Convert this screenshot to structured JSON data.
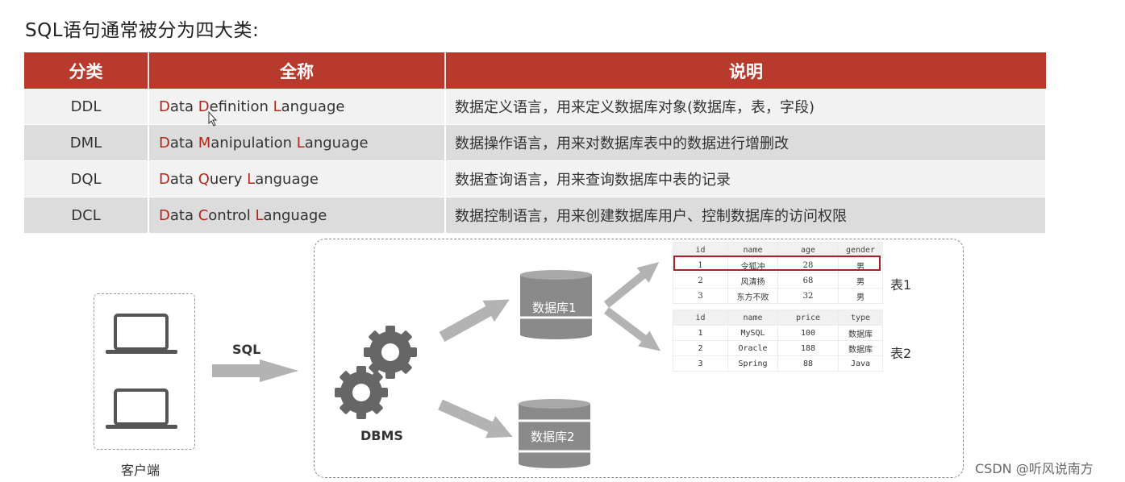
{
  "heading": "SQL语句通常被分为四大类:",
  "table": {
    "headers": [
      "分类",
      "全称",
      "说明"
    ],
    "rows": [
      {
        "abbr": "DDL",
        "full": [
          [
            "D",
            "ata "
          ],
          [
            "D",
            "efinition "
          ],
          [
            "L",
            "anguage"
          ]
        ],
        "desc": "数据定义语言，用来定义数据库对象(数据库，表，字段)"
      },
      {
        "abbr": "DML",
        "full": [
          [
            "D",
            "ata "
          ],
          [
            "M",
            "anipulation "
          ],
          [
            "L",
            "anguage"
          ]
        ],
        "desc": "数据操作语言，用来对数据库表中的数据进行增删改"
      },
      {
        "abbr": "DQL",
        "full": [
          [
            "D",
            "ata "
          ],
          [
            "Q",
            "uery "
          ],
          [
            "L",
            "anguage"
          ]
        ],
        "desc": "数据查询语言，用来查询数据库中表的记录"
      },
      {
        "abbr": "DCL",
        "full": [
          [
            "D",
            "ata "
          ],
          [
            "C",
            "ontrol "
          ],
          [
            "L",
            "anguage"
          ]
        ],
        "desc": "数据控制语言，用来创建数据库用户、控制数据库的访问权限"
      }
    ]
  },
  "diagram": {
    "client_label": "客户端",
    "sql_label": "SQL",
    "dbms_label": "DBMS",
    "db1_label": "数据库1",
    "db2_label": "数据库2",
    "table1_label": "表1",
    "table2_label": "表2",
    "table1": {
      "headers": [
        "id",
        "name",
        "age",
        "gender"
      ],
      "rows": [
        [
          "1",
          "令狐冲",
          "28",
          "男"
        ],
        [
          "2",
          "风清扬",
          "68",
          "男"
        ],
        [
          "3",
          "东方不败",
          "32",
          "男"
        ]
      ]
    },
    "table2": {
      "headers": [
        "id",
        "name",
        "price",
        "type"
      ],
      "rows": [
        [
          "1",
          "MySQL",
          "100",
          "数据库"
        ],
        [
          "2",
          "Oracle",
          "188",
          "数据库"
        ],
        [
          "3",
          "Spring",
          "88",
          "Java"
        ]
      ]
    }
  },
  "watermark": "CSDN @听风说南方",
  "colors": {
    "header_red": "#b83a2d",
    "initial_red": "#b0271a",
    "highlight_red": "#a4232a"
  },
  "icons": [
    "laptop-icon",
    "gear-icon",
    "database-icon",
    "arrow-icon",
    "mouse-cursor-icon"
  ]
}
